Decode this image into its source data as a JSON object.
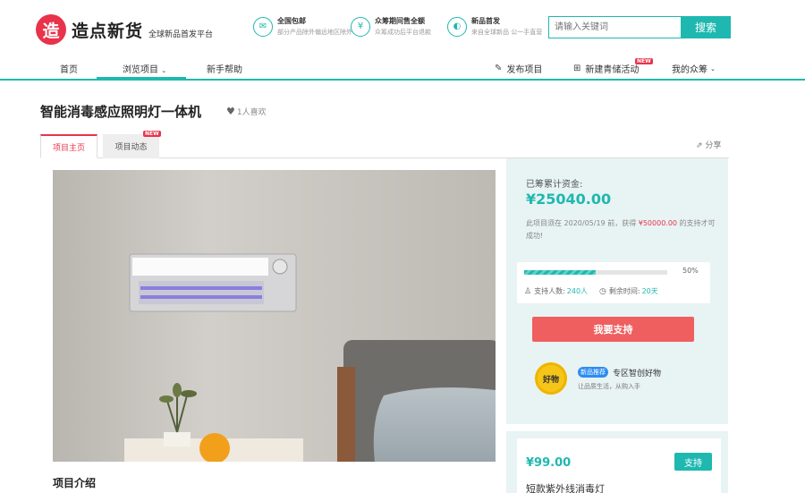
{
  "header": {
    "logo_mark": "造",
    "logo_name": "造点新货",
    "logo_tagline": "全球新品首发平台",
    "features": [
      {
        "title": "全国包邮",
        "sub": "部分产品除外偏远地区除外",
        "icon": "gift-icon"
      },
      {
        "title": "众筹期间售全额",
        "sub": "众筹成功后平台退款",
        "icon": "shield-icon"
      },
      {
        "title": "新品首发",
        "sub": "来自全球新品 公一手直营",
        "icon": "speaker-icon"
      }
    ],
    "search_placeholder": "请输入关键词",
    "search_button": "搜索"
  },
  "nav": {
    "items": [
      {
        "label": "首页"
      },
      {
        "label": "浏览项目"
      },
      {
        "label": "新手帮助"
      }
    ],
    "right": [
      {
        "label": "发布项目",
        "icon": "edit-icon"
      },
      {
        "label": "新建青储活动",
        "icon": "gift-box-icon",
        "badge": "NEW"
      },
      {
        "label": "我的众筹",
        "icon": "chevron-down-icon"
      }
    ]
  },
  "page": {
    "title": "智能消毒感应照明灯一体机",
    "fav_count": "1人喜欢",
    "tabs": [
      {
        "label": "项目主页"
      },
      {
        "label": "项目动态",
        "badge": "NEW"
      }
    ],
    "share": "分享",
    "intro_heading": "项目介绍"
  },
  "funding": {
    "label": "已筹累计资金:",
    "amount": "¥25040.00",
    "desc_pre": "此项目须在 2020/05/19 前，获得 ",
    "target": "¥50000.00",
    "desc_post": " 的支持才可成功!",
    "progress_pct": 50,
    "progress_label": "50%",
    "backers_label": "支持人数:",
    "backers": "240人",
    "time_label": "剩余时间:",
    "time": "20天",
    "support_button": "我要支持"
  },
  "advertiser": {
    "logo_text": "好物",
    "tag": "新品推荐",
    "name": "专区智创好物",
    "sub": "让品质生活，从购入手"
  },
  "reward": {
    "price": "¥99.00",
    "button": "支持",
    "name": "短款紫外线消毒灯"
  },
  "colors": {
    "accent": "#1fb8b0",
    "brand_red": "#e8334a",
    "button_red": "#ef5f5f"
  }
}
